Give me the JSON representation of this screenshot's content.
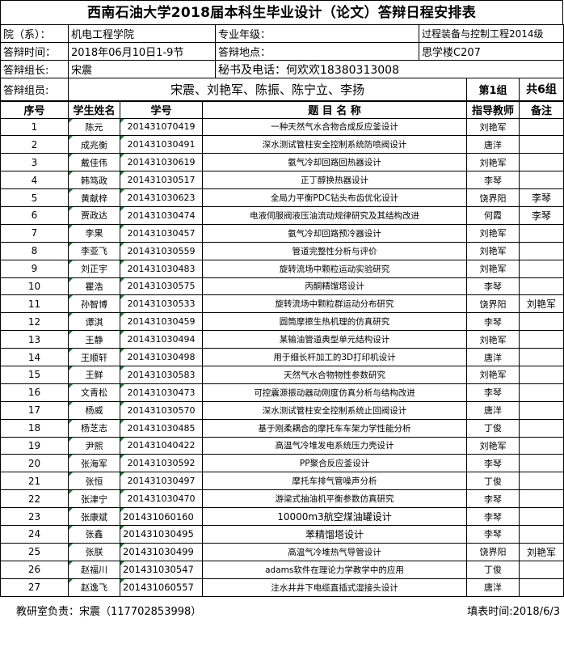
{
  "title": "西南石油大学2018届本科生毕业设计（论文）答辩日程安排表",
  "info": {
    "college_label": "院（系）：",
    "college_value": "机电工程学院",
    "major_label": "专业年级：",
    "major_value": "过程装备与控制工程2014级",
    "time_label": "答辩时间：",
    "time_value": "2018年06月10日1-9节",
    "place_label": "答辩地点：",
    "place_value": "思学楼C207",
    "leader_label": "答辩组长:",
    "leader_value": "宋震",
    "secretary_text": "秘书及电话：何欢欢18380313008",
    "members_label": "答辩组员:",
    "members_value": "宋震、刘艳军、陈振、陈宁立、李扬",
    "group_label": "第1组",
    "total_label": "共6组"
  },
  "headers": {
    "no": "序号",
    "name": "学生姓名",
    "id": "学号",
    "topic": "题 目 名 称",
    "advisor": "指导教师",
    "note": "备注"
  },
  "students": [
    {
      "no": "1",
      "name": "陈元",
      "id": "201431070419",
      "topic": "一种天然气水合物合成反应釜设计",
      "advisor": "刘艳军",
      "note": ""
    },
    {
      "no": "2",
      "name": "成兆衡",
      "id": "201431030491",
      "topic": "深水测试管柱安全控制系统防喷阀设计",
      "advisor": "唐洋",
      "note": ""
    },
    {
      "no": "3",
      "name": "戴佳伟",
      "id": "201431030619",
      "topic": "氨气冷却回路回热器设计",
      "advisor": "刘艳军",
      "note": ""
    },
    {
      "no": "4",
      "name": "韩笃政",
      "id": "201431030517",
      "topic": "正丁醇换热器设计",
      "advisor": "李琴",
      "note": ""
    },
    {
      "no": "5",
      "name": "黄献梓",
      "id": "201431030623",
      "topic": "全局力平衡PDC钻头布齿优化设计",
      "advisor": "饶界阳",
      "note": "李琴"
    },
    {
      "no": "6",
      "name": "贾政达",
      "id": "201431030474",
      "topic": "电液伺服阀液压油流动规律研究及其结构改进",
      "advisor": "何霞",
      "note": "李琴"
    },
    {
      "no": "7",
      "name": "李果",
      "id": "201431030457",
      "topic": "氨气冷却回路预冷器设计",
      "advisor": "刘艳军",
      "note": ""
    },
    {
      "no": "8",
      "name": "李亚飞",
      "id": "201431030559",
      "topic": "管道完整性分析与评价",
      "advisor": "刘艳军",
      "note": ""
    },
    {
      "no": "9",
      "name": "刘正宇",
      "id": "201431030483",
      "topic": "旋转流场中颗粒运动实验研究",
      "advisor": "刘艳军",
      "note": ""
    },
    {
      "no": "10",
      "name": "瞿浩",
      "id": "201431030575",
      "topic": "丙酮精馏塔设计",
      "advisor": "李琴",
      "note": ""
    },
    {
      "no": "11",
      "name": "孙智博",
      "id": "201431030533",
      "topic": "旋转流场中颗粒群运动分布研究",
      "advisor": "饶界阳",
      "note": "刘艳军"
    },
    {
      "no": "12",
      "name": "谭淇",
      "id": "201431030459",
      "topic": "圆筒摩擦生热机理的仿真研究",
      "advisor": "李琴",
      "note": ""
    },
    {
      "no": "13",
      "name": "王静",
      "id": "201431030494",
      "topic": "某输油管道典型单元结构设计",
      "advisor": "刘艳军",
      "note": ""
    },
    {
      "no": "14",
      "name": "王顺轩",
      "id": "201431030498",
      "topic": "用于细长杆加工的3D打印机设计",
      "advisor": "唐洋",
      "note": ""
    },
    {
      "no": "15",
      "name": "王鲜",
      "id": "201431030583",
      "topic": "天然气水合物物性参数研究",
      "advisor": "刘艳军",
      "note": ""
    },
    {
      "no": "16",
      "name": "文青松",
      "id": "201431030473",
      "topic": "可控震源振动器动刚度仿真分析与结构改进",
      "advisor": "李琴",
      "note": ""
    },
    {
      "no": "17",
      "name": "杨威",
      "id": "201431030570",
      "topic": "深水测试管柱安全控制系统止回阀设计",
      "advisor": "唐洋",
      "note": ""
    },
    {
      "no": "18",
      "name": "杨芝志",
      "id": "201431030485",
      "topic": "基于刚柔耦合的摩托车车架力学性能分析",
      "advisor": "丁俊",
      "note": ""
    },
    {
      "no": "19",
      "name": "尹熙",
      "id": "201431040422",
      "topic": "高温气冷堆发电系统压力壳设计",
      "advisor": "刘艳军",
      "note": ""
    },
    {
      "no": "20",
      "name": "张海军",
      "id": "201431030592",
      "topic": "PP聚合反应釜设计",
      "advisor": "李琴",
      "note": ""
    },
    {
      "no": "21",
      "name": "张恒",
      "id": "201431030497",
      "topic": "摩托车排气管噪声分析",
      "advisor": "丁俊",
      "note": ""
    },
    {
      "no": "22",
      "name": "张津宁",
      "id": "201431030470",
      "topic": "游梁式抽油机平衡参数仿真研究",
      "advisor": "李琴",
      "note": ""
    },
    {
      "no": "23",
      "name": "张康斌",
      "id": "201431060160",
      "topic": "10000m3航空煤油罐设计",
      "advisor": "李琴",
      "note": ""
    },
    {
      "no": "24",
      "name": "张鑫",
      "id": "201431030495",
      "topic": "苯精馏塔设计",
      "advisor": "李琴",
      "note": ""
    },
    {
      "no": "25",
      "name": "张朕",
      "id": "201431030499",
      "topic": "高温气冷堆热气导管设计",
      "advisor": "饶界阳",
      "note": "刘艳军"
    },
    {
      "no": "26",
      "name": "赵福川",
      "id": "201431030547",
      "topic": "adams软件在理论力学教学中的应用",
      "advisor": "丁俊",
      "note": ""
    },
    {
      "no": "27",
      "name": "赵逸飞",
      "id": "201431060557",
      "topic": "注水井井下电缆直插式湿接头设计",
      "advisor": "唐洋",
      "note": ""
    }
  ],
  "footer": {
    "office": "教研室负责：宋震（117702853998）",
    "filled": "填表时间:2018/6/3"
  },
  "colors": {
    "comment_marker": "#1e7b34"
  }
}
